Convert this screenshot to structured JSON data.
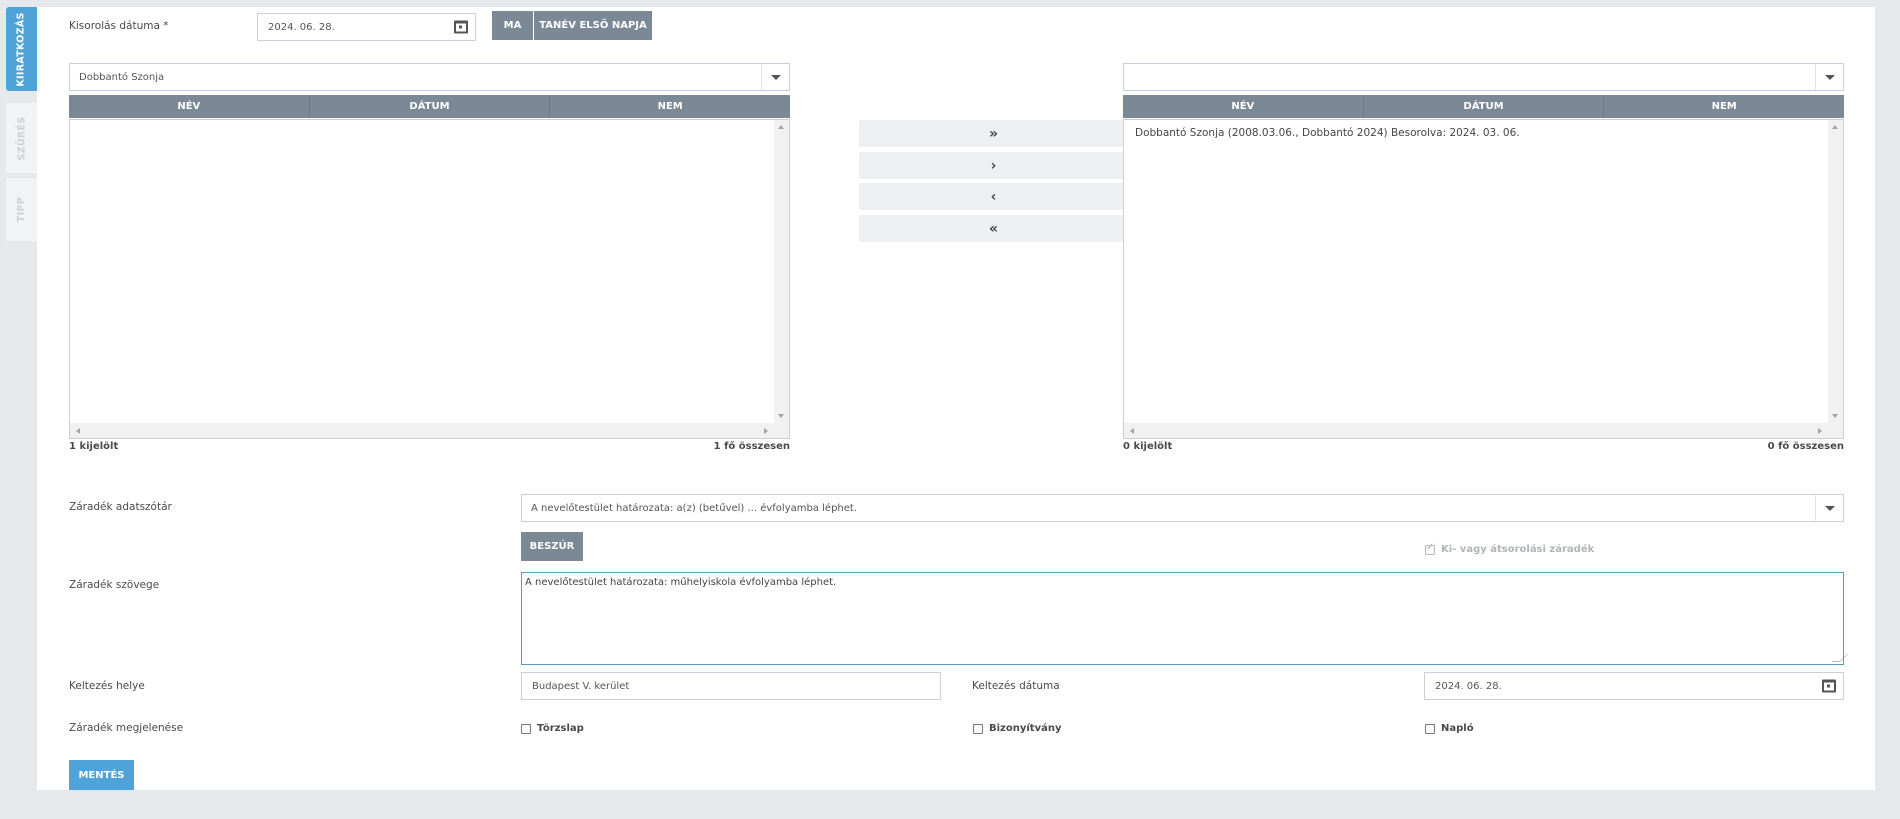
{
  "sidebar": {
    "tabs": [
      {
        "label": "KIIRATKOZÁS",
        "active": true
      },
      {
        "label": "SZŰRÉS",
        "active": false
      },
      {
        "label": "TIPP",
        "active": false
      }
    ]
  },
  "header": {
    "date_label": "Kisorolás dátuma *",
    "date_value": "2024. 06. 28.",
    "today_button": "MA",
    "first_day_button": "TANÉV ELSŐ NAPJA"
  },
  "left_list": {
    "select_value": "Dobbantó Szonja",
    "columns": [
      "NÉV",
      "DÁTUM",
      "NEM"
    ],
    "rows": [],
    "selected_count": "1 kijelölt",
    "total_count": "1 fő összesen"
  },
  "right_list": {
    "select_value": "",
    "columns": [
      "NÉV",
      "DÁTUM",
      "NEM"
    ],
    "rows": [
      "Dobbantó Szonja (2008.03.06., Dobbantó 2024) Besorolva: 2024. 03. 06."
    ],
    "selected_count": "0 kijelölt",
    "total_count": "0 fő összesen"
  },
  "move_buttons": [
    "»",
    "›",
    "‹",
    "«"
  ],
  "form": {
    "dictionary_label": "Záradék adatszótár",
    "dictionary_value": "A nevelőtestület határozata: a(z) (betűvel) ... évfolyamba léphet.",
    "insert_button": "BESZÚR",
    "reassign_checkbox_label": "Ki- vagy átsorolási záradék",
    "reassign_checked": true,
    "text_label": "Záradék szövege",
    "text_value": "A nevelőtestület határozata: műhelyiskola évfolyamba léphet.",
    "place_label": "Keltezés helye",
    "place_value": "Budapest V. kerület",
    "issue_date_label": "Keltezés dátuma",
    "issue_date_value": "2024. 06. 28.",
    "appearance_label": "Záradék megjelenése",
    "appearance_options": [
      {
        "label": "Törzslap",
        "checked": false
      },
      {
        "label": "Bizonyítvány",
        "checked": false
      },
      {
        "label": "Napló",
        "checked": false
      }
    ],
    "save_button": "MENTÉS"
  },
  "colors": {
    "accent": "#4fa3d9",
    "grid_header": "#7b8896",
    "background": "#e6e9ec"
  }
}
